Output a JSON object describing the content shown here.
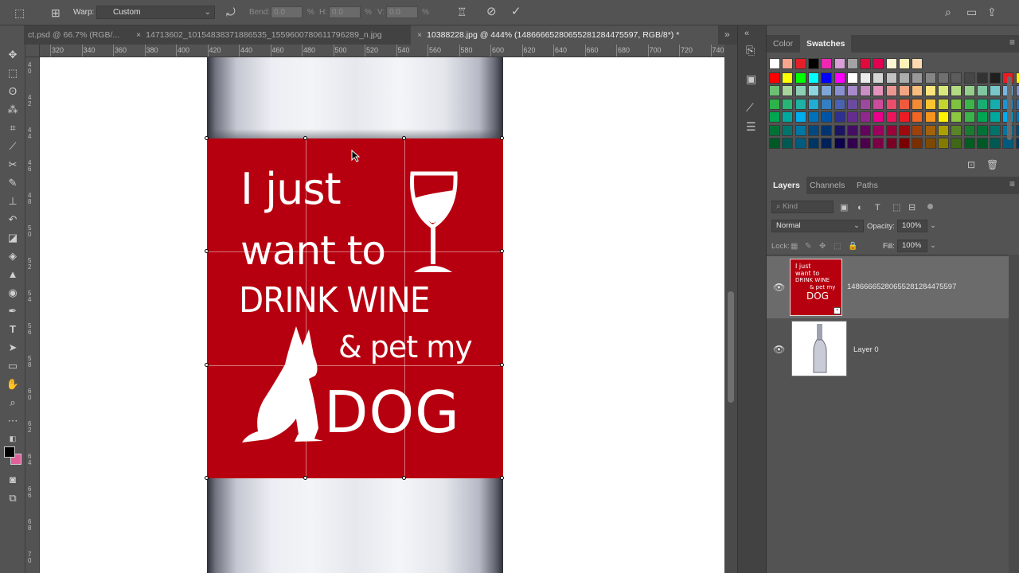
{
  "options_bar": {
    "warp_label": "Warp:",
    "warp_value": "Custom",
    "bend_label": "Bend:",
    "bend_value": "0.0",
    "bend_unit": "%",
    "h_label": "H:",
    "h_value": "0.0",
    "h_unit": "%",
    "v_label": "V:",
    "v_value": "0.0",
    "v_unit": "%"
  },
  "tabs": [
    {
      "label": "ct.psd @ 66.7% (RGB/...",
      "close": "×"
    },
    {
      "label": "14713602_10154838371886535_1559600780611796289_n.jpg",
      "close": "×"
    },
    {
      "label": "10388228.jpg @ 444% (1486666528065528128447559​7, RGB/8*) *",
      "close": "×"
    }
  ],
  "ruler_h": [
    "320",
    "340",
    "360",
    "380",
    "400",
    "420",
    "440",
    "460",
    "480",
    "500",
    "520",
    "540",
    "560",
    "580",
    "600",
    "620",
    "640",
    "660",
    "680",
    "700",
    "720",
    "740"
  ],
  "ruler_v": [
    "4\n0",
    "4\n2",
    "4\n4",
    "4\n6",
    "4\n8",
    "5\n0",
    "5\n2",
    "5\n4",
    "5\n6",
    "5\n8",
    "6\n0",
    "6\n2",
    "6\n4",
    "6\n6",
    "6\n8",
    "7\n0"
  ],
  "artwork": {
    "line1": "I just",
    "line2": "want to",
    "line3": "DRINK WINE",
    "line4": "& pet my",
    "line5": "DOG"
  },
  "colors": {
    "label_red": "#b7000f",
    "foreground": "#000000",
    "background": "#e0609a"
  },
  "color_panel": {
    "tab_color": "Color",
    "tab_swatches": "Swatches"
  },
  "swatch_rows": [
    [
      "#ffffff",
      "#f7a58f",
      "#e41f2a",
      "#000000",
      "#ed29b4",
      "#d8a0d6",
      "#a3a3a3",
      "#e00a3c",
      "#e20051",
      "#fff6d4",
      "#fff2b8",
      "#ffd9b0"
    ],
    [
      "#ff0000",
      "#ffff00",
      "#00ff00",
      "#00ffff",
      "#0000ff",
      "#ff00ff",
      "#ffffff",
      "#ebebeb",
      "#d6d6d6",
      "#c2c2c2",
      "#adadad",
      "#999999",
      "#858585",
      "#707070",
      "#5c5c5c",
      "#474747",
      "#333333",
      "#1f1f1f",
      "#ed1c24",
      "#fff200"
    ],
    [
      "#6bc072",
      "#a8d59b",
      "#8dcfb4",
      "#8ed6df",
      "#7fa6d6",
      "#8a8fd1",
      "#a78acb",
      "#c890c4",
      "#e593bc",
      "#ec9691",
      "#f3a582",
      "#f6bd7e",
      "#fbe57c",
      "#d9e97c",
      "#b3db82",
      "#94cf8b",
      "#80c6a0",
      "#79c7c9",
      "#78b5e0",
      "#7a8fcf"
    ],
    [
      "#2cb34a",
      "#29b574",
      "#1db2a3",
      "#22abd3",
      "#337fc3",
      "#4a63b1",
      "#6a4ba0",
      "#9b4a9c",
      "#cc4b9b",
      "#ec4d6d",
      "#ef5a3c",
      "#f38b34",
      "#f8c42f",
      "#c3d52e",
      "#7dc340",
      "#3bb54a",
      "#19ad74",
      "#17adad",
      "#1f93d1",
      "#2f6fb8"
    ],
    [
      "#00a650",
      "#00a99d",
      "#00aeef",
      "#0072bc",
      "#0054a6",
      "#2e3192",
      "#662d91",
      "#92278f",
      "#ec008c",
      "#ed145b",
      "#ed1c24",
      "#f26522",
      "#f7941d",
      "#fff200",
      "#8dc63f",
      "#39b54a",
      "#00a651",
      "#00a99d",
      "#00aeef",
      "#0072bc"
    ],
    [
      "#007236",
      "#00746b",
      "#0076a3",
      "#004a80",
      "#003471",
      "#1b1464",
      "#440e62",
      "#630460",
      "#9e005d",
      "#9e0039",
      "#9e0b0f",
      "#a0410d",
      "#a36209",
      "#aba000",
      "#598527",
      "#197b30",
      "#007236",
      "#00746b",
      "#0076a3",
      "#004a80"
    ],
    [
      "#005826",
      "#005952",
      "#005b7f",
      "#003663",
      "#002157",
      "#0d004c",
      "#32004b",
      "#4b0049",
      "#7b0046",
      "#7a0026",
      "#790000",
      "#7b2e00",
      "#7d4900",
      "#827b00",
      "#406618",
      "#005e20",
      "#005826",
      "#005952",
      "#005b7f",
      "#003663"
    ]
  ],
  "layers_panel": {
    "tab_layers": "Layers",
    "tab_channels": "Channels",
    "tab_paths": "Paths",
    "filter_placeholder": "Kind",
    "blend_mode": "Normal",
    "opacity_label": "Opacity:",
    "opacity_value": "100%",
    "lock_label": "Lock:",
    "fill_label": "Fill:",
    "fill_value": "100%",
    "layers": [
      {
        "name": "14866665280655281284475597",
        "selected": true
      },
      {
        "name": "Layer 0",
        "selected": false
      }
    ]
  }
}
